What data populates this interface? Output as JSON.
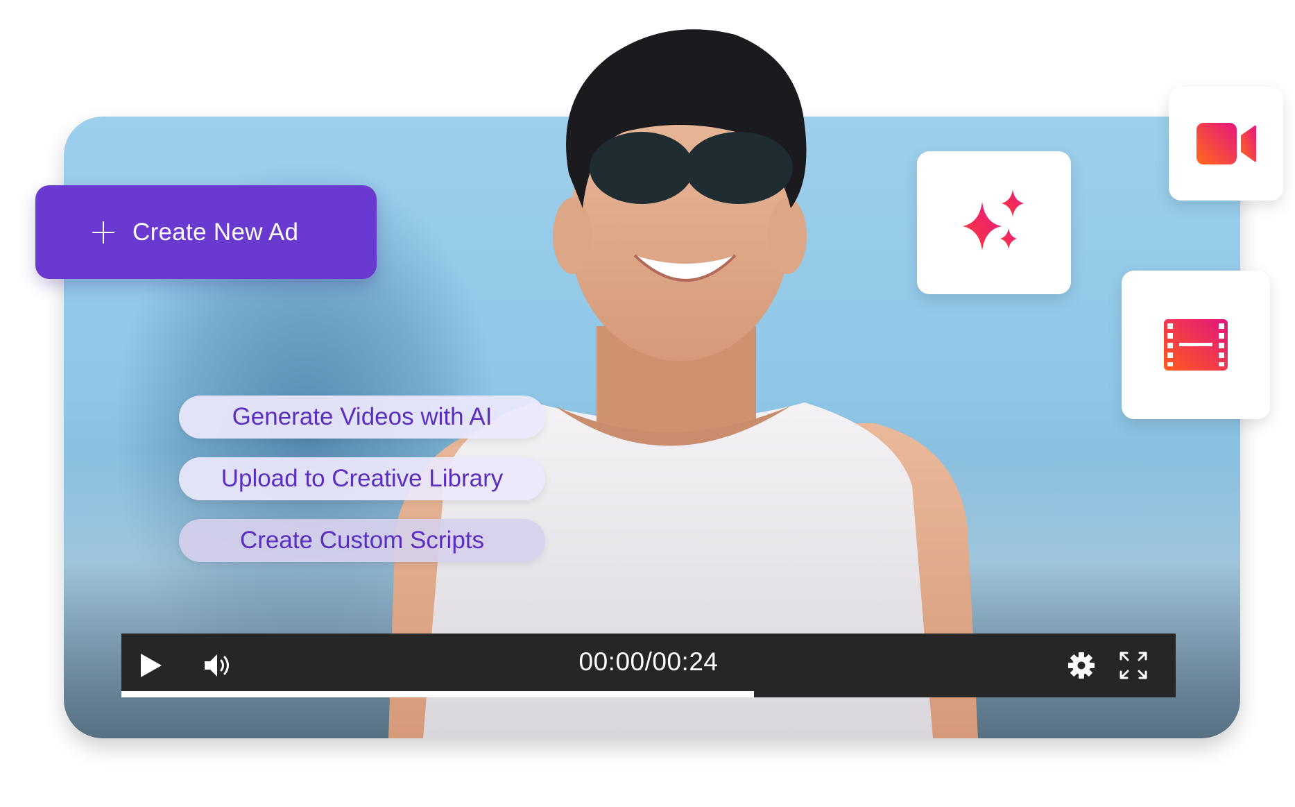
{
  "create_ad": {
    "label": "Create New Ad"
  },
  "features": [
    {
      "label": "Generate Videos with AI"
    },
    {
      "label": "Upload to Creative Library"
    },
    {
      "label": "Create Custom Scripts"
    }
  ],
  "cards": [
    {
      "icon": "sparkle-icon"
    },
    {
      "icon": "video-camera-icon"
    },
    {
      "icon": "film-strip-icon"
    }
  ],
  "player": {
    "time": "00:00/00:24",
    "progress": 0.6,
    "controls": [
      "play-icon",
      "volume-icon",
      "settings-gear-icon",
      "fullscreen-icon"
    ]
  },
  "colors": {
    "brand_purple": "#6a3ad0",
    "pill_text": "#5b2ec0",
    "player_bg": "#262626",
    "sky": "#9ccfec"
  }
}
